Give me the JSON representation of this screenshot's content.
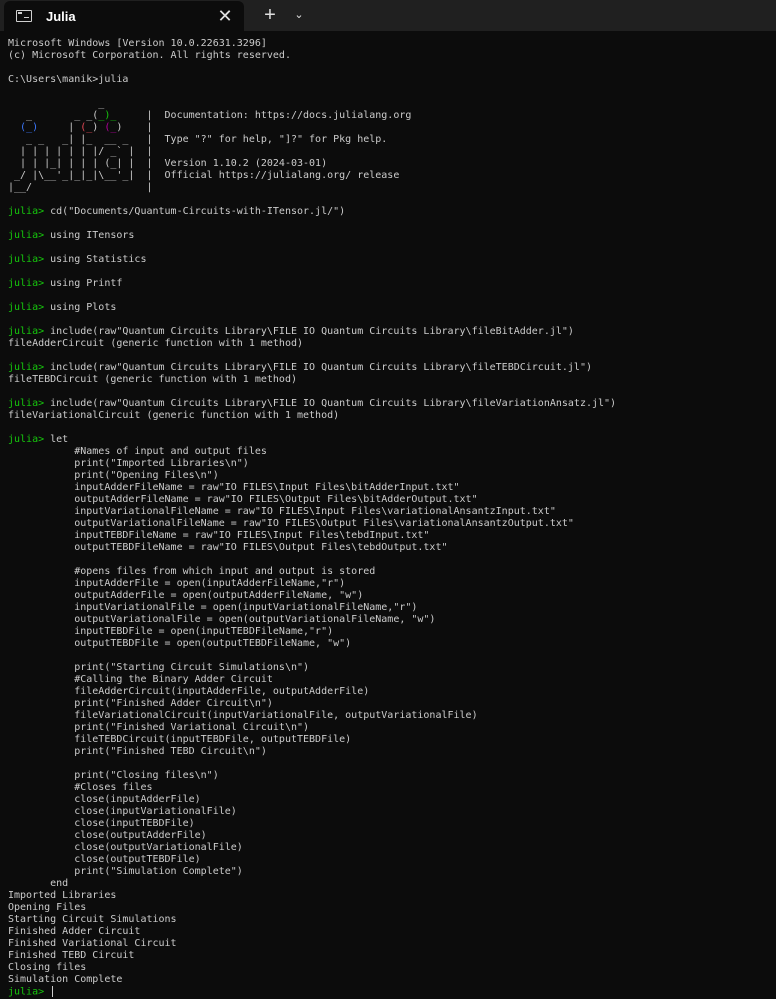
{
  "window": {
    "tab_title": "Julia",
    "new_tab": "+",
    "dropdown": "⌄",
    "close": "✕"
  },
  "terminal": {
    "header": [
      "Microsoft Windows [Version 10.0.22631.3296]",
      "(c) Microsoft Corporation. All rights reserved.",
      "",
      "C:\\Users\\manik>julia",
      ""
    ],
    "banner": {
      "logo": [
        "               _",
        "   _       _ _(_)_     |",
        "  (_)     | (_) (_)    |",
        "   _ _   _| |_  __ _   |",
        "  | | | | | | |/ _` |  |",
        "  | | |_| | | | (_| |  |",
        " _/ |\\__'_|_|_|\\__'_|  |",
        "|__/                   |"
      ],
      "info": [
        "",
        "  Documentation: https://docs.julialang.org",
        "",
        "  Type \"?\" for help, \"]?\" for Pkg help.",
        "",
        "  Version 1.10.2 (2024-03-01)",
        "  Official https://julialang.org/ release",
        ""
      ]
    },
    "prompt": "julia>",
    "lines": [
      {
        "t": ""
      },
      {
        "p": true,
        "t": " cd(\"Documents/Quantum-Circuits-with-ITensor.jl/\")"
      },
      {
        "t": ""
      },
      {
        "p": true,
        "t": " using ITensors"
      },
      {
        "t": ""
      },
      {
        "p": true,
        "t": " using Statistics"
      },
      {
        "t": ""
      },
      {
        "p": true,
        "t": " using Printf"
      },
      {
        "t": ""
      },
      {
        "p": true,
        "t": " using Plots"
      },
      {
        "t": ""
      },
      {
        "p": true,
        "t": " include(raw\"Quantum Circuits Library\\FILE IO Quantum Circuits Library\\fileBitAdder.jl\")"
      },
      {
        "t": "fileAdderCircuit (generic function with 1 method)"
      },
      {
        "t": ""
      },
      {
        "p": true,
        "t": " include(raw\"Quantum Circuits Library\\FILE IO Quantum Circuits Library\\fileTEBDCircuit.jl\")"
      },
      {
        "t": "fileTEBDCircuit (generic function with 1 method)"
      },
      {
        "t": ""
      },
      {
        "p": true,
        "t": " include(raw\"Quantum Circuits Library\\FILE IO Quantum Circuits Library\\fileVariationAnsatz.jl\")"
      },
      {
        "t": "fileVariationalCircuit (generic function with 1 method)"
      },
      {
        "t": ""
      },
      {
        "p": true,
        "t": " let"
      },
      {
        "t": "           #Names of input and output files"
      },
      {
        "t": "           print(\"Imported Libraries\\n\")"
      },
      {
        "t": "           print(\"Opening Files\\n\")"
      },
      {
        "t": "           inputAdderFileName = raw\"IO FILES\\Input Files\\bitAdderInput.txt\""
      },
      {
        "t": "           outputAdderFileName = raw\"IO FILES\\Output Files\\bitAdderOutput.txt\""
      },
      {
        "t": "           inputVariationalFileName = raw\"IO FILES\\Input Files\\variationalAnsantzInput.txt\""
      },
      {
        "t": "           outputVariationalFileName = raw\"IO FILES\\Output Files\\variationalAnsantzOutput.txt\""
      },
      {
        "t": "           inputTEBDFileName = raw\"IO FILES\\Input Files\\tebdInput.txt\""
      },
      {
        "t": "           outputTEBDFileName = raw\"IO FILES\\Output Files\\tebdOutput.txt\""
      },
      {
        "t": ""
      },
      {
        "t": "           #opens files from which input and output is stored"
      },
      {
        "t": "           inputAdderFile = open(inputAdderFileName,\"r\")"
      },
      {
        "t": "           outputAdderFile = open(outputAdderFileName, \"w\")"
      },
      {
        "t": "           inputVariationalFile = open(inputVariationalFileName,\"r\")"
      },
      {
        "t": "           outputVariationalFile = open(outputVariationalFileName, \"w\")"
      },
      {
        "t": "           inputTEBDFile = open(inputTEBDFileName,\"r\")"
      },
      {
        "t": "           outputTEBDFile = open(outputTEBDFileName, \"w\")"
      },
      {
        "t": ""
      },
      {
        "t": "           print(\"Starting Circuit Simulations\\n\")"
      },
      {
        "t": "           #Calling the Binary Adder Circuit"
      },
      {
        "t": "           fileAdderCircuit(inputAdderFile, outputAdderFile)"
      },
      {
        "t": "           print(\"Finished Adder Circuit\\n\")"
      },
      {
        "t": "           fileVariationalCircuit(inputVariationalFile, outputVariationalFile)"
      },
      {
        "t": "           print(\"Finished Variational Circuit\\n\")"
      },
      {
        "t": "           fileTEBDCircuit(inputTEBDFile, outputTEBDFile)"
      },
      {
        "t": "           print(\"Finished TEBD Circuit\\n\")"
      },
      {
        "t": ""
      },
      {
        "t": "           print(\"Closing files\\n\")"
      },
      {
        "t": "           #Closes files"
      },
      {
        "t": "           close(inputAdderFile)"
      },
      {
        "t": "           close(inputVariationalFile)"
      },
      {
        "t": "           close(inputTEBDFile)"
      },
      {
        "t": "           close(outputAdderFile)"
      },
      {
        "t": "           close(outputVariationalFile)"
      },
      {
        "t": "           close(outputTEBDFile)"
      },
      {
        "t": "           print(\"Simulation Complete\")"
      },
      {
        "t": "       end"
      },
      {
        "t": "Imported Libraries"
      },
      {
        "t": "Opening Files"
      },
      {
        "t": "Starting Circuit Simulations"
      },
      {
        "t": "Finished Adder Circuit"
      },
      {
        "t": "Finished Variational Circuit"
      },
      {
        "t": "Finished TEBD Circuit"
      },
      {
        "t": "Closing files"
      },
      {
        "t": "Simulation Complete"
      },
      {
        "p": true,
        "t": " ",
        "cursor": true
      }
    ]
  }
}
